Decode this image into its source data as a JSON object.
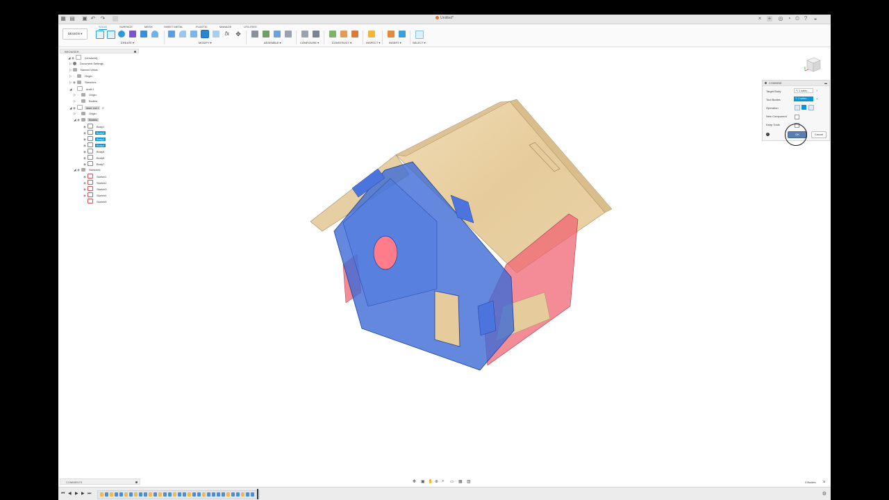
{
  "window": {
    "document_title": "Untitled*"
  },
  "toolbar": {
    "workspace_button": "DESIGN ▾",
    "tabs": [
      "SOLID",
      "SURFACE",
      "MESH",
      "SHEET METAL",
      "PLASTIC",
      "MANAGE",
      "UTILITIES"
    ],
    "active_tab": "SOLID",
    "groups": [
      "CREATE ▾",
      "MODIFY ▾",
      "ASSEMBLE ▾",
      "CONFIGURE ▾",
      "CONSTRUCT ▾",
      "INSPECT ▾",
      "INSERT ▾",
      "SELECT ▾"
    ],
    "fx_label": "fx"
  },
  "browser": {
    "title": "BROWSER",
    "items": [
      {
        "label": "(Unsaved)",
        "level": 0,
        "icon": "component"
      },
      {
        "label": "Document Settings",
        "level": 1,
        "icon": "gear"
      },
      {
        "label": "Named Views",
        "level": 1,
        "icon": "folder"
      },
      {
        "label": "Origin",
        "level": 1,
        "icon": "folder"
      },
      {
        "label": "Sketches",
        "level": 1,
        "icon": "folder"
      },
      {
        "label": "draft:1",
        "level": 1,
        "icon": "component"
      },
      {
        "label": "Origin",
        "level": 2,
        "icon": "folder"
      },
      {
        "label": "Bodies",
        "level": 2,
        "icon": "folder"
      },
      {
        "label": "laser cut:1",
        "level": 1,
        "icon": "component"
      },
      {
        "label": "Origin",
        "level": 2,
        "icon": "folder"
      },
      {
        "label": "Bodies",
        "level": 2,
        "icon": "folder"
      },
      {
        "label": "Body1",
        "level": 3,
        "icon": "body"
      },
      {
        "label": "Body2",
        "level": 3,
        "icon": "body"
      },
      {
        "label": "Body3",
        "level": 3,
        "icon": "body"
      },
      {
        "label": "Body4",
        "level": 3,
        "icon": "body"
      },
      {
        "label": "Body5",
        "level": 3,
        "icon": "body"
      },
      {
        "label": "Body6",
        "level": 3,
        "icon": "body"
      },
      {
        "label": "Body7",
        "level": 3,
        "icon": "body"
      },
      {
        "label": "Sketches",
        "level": 2,
        "icon": "folder"
      },
      {
        "label": "Sketch1",
        "level": 3,
        "icon": "sketch"
      },
      {
        "label": "Sketch2",
        "level": 3,
        "icon": "sketch"
      },
      {
        "label": "Sketch3",
        "level": 3,
        "icon": "sketch"
      },
      {
        "label": "Sketch4",
        "level": 3,
        "icon": "sketch"
      },
      {
        "label": "Sketch5",
        "level": 3,
        "icon": "sketch"
      }
    ]
  },
  "combine_panel": {
    "title": "COMBINE",
    "target_body_label": "Target Body",
    "target_body_value": "1 selec...",
    "tool_bodies_label": "Tool Bodies",
    "tool_bodies_value": "2 selec...",
    "operation_label": "Operation",
    "new_component_label": "New Component",
    "keep_tools_label": "Keep Tools",
    "ok_label": "OK",
    "cancel_label": "Cancel"
  },
  "bottom": {
    "comments_label": "COMMENTS",
    "status": "3 Bodies"
  },
  "colors": {
    "accent": "#0696d7",
    "wood": "#e8cfa2",
    "blue_body": "#3c6ad6",
    "red_body": "#f06070"
  }
}
